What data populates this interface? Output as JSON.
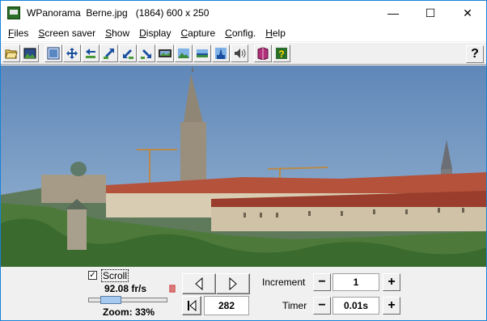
{
  "window": {
    "title": "WPanorama  Berne.jpg   (1864) 600 x 250",
    "controls": {
      "minimize": "—",
      "maximize": "☐",
      "close": "✕"
    }
  },
  "menu": [
    {
      "label": "Files",
      "key": "F"
    },
    {
      "label": "Screen saver",
      "key": "S"
    },
    {
      "label": "Show",
      "key": "S"
    },
    {
      "label": "Display",
      "key": "D"
    },
    {
      "label": "Capture",
      "key": "C"
    },
    {
      "label": "Config.",
      "key": "C"
    },
    {
      "label": "Help",
      "key": "H"
    }
  ],
  "toolbar": {
    "icons": [
      "open-file-icon",
      "picture-icon",
      "fit-window-icon",
      "move-icon",
      "scroll-left-icon",
      "scroll-up-right-icon",
      "scroll-down-left-icon",
      "scroll-down-right-icon",
      "film-strip-icon",
      "landscape-icon",
      "horizon-icon",
      "center-tower-icon",
      "sound-icon",
      "book-icon",
      "help-book-icon"
    ],
    "help_label": "?"
  },
  "controls": {
    "scroll_label": "Scroll",
    "scroll_checked": "✓",
    "fps": "92.08 fr/s",
    "zoom": "Zoom: 33%",
    "zoom_fraction": 0.33,
    "position": "282",
    "increment_label": "Increment",
    "increment_value": "1",
    "timer_label": "Timer",
    "timer_value": "0.01s",
    "minus": "−",
    "plus": "+"
  },
  "colors": {
    "title_border": "#1883d7",
    "sky": "#6f93bd"
  }
}
